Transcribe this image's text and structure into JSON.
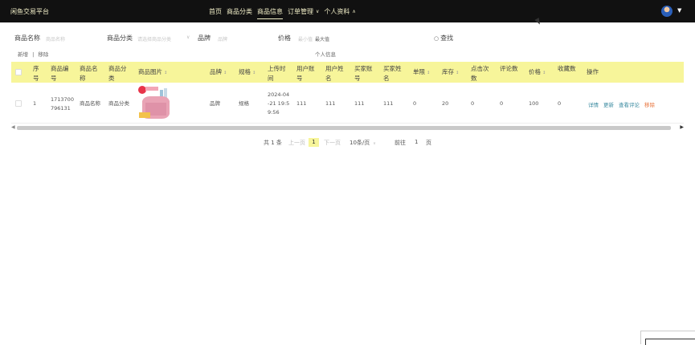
{
  "brand": "闲鱼交易平台",
  "nav": {
    "home": "首页",
    "category": "商品分类",
    "goods_info": "商品信息",
    "order_mgmt": "订单管理",
    "profile": "个人资料"
  },
  "search": {
    "name_label": "商品名称",
    "name_placeholder": "商品名称",
    "category_label": "商品分类",
    "category_placeholder": "请选择商品分类",
    "brand_label": "品牌",
    "brand_placeholder": "品牌",
    "price_label": "价格",
    "price_min_placeholder": "最小值",
    "price_max_placeholder": "最大值",
    "find_button": "查找"
  },
  "toolbar": {
    "add": "新增",
    "divider": "|",
    "remove": "移除",
    "center_text": "个人信息"
  },
  "table": {
    "headers": {
      "index": "序号",
      "code": "商品编号",
      "name": "商品名称",
      "category": "商品分类",
      "image": "商品图片",
      "brand": "品牌",
      "spec": "规格",
      "time": "上传时间",
      "user_account": "用户账号",
      "user_name": "用户姓名",
      "buyer_account": "买家账号",
      "buyer_name": "买家姓名",
      "limit": "单限",
      "stock": "库存",
      "clicks": "点击次数",
      "comments": "评论数",
      "price": "价格",
      "favorites": "收藏数",
      "ops": "操作"
    },
    "row": {
      "index": "1",
      "code_line1": "1713700",
      "code_line2": "796131",
      "name": "商品名称",
      "category": "商品分类",
      "brand": "品牌",
      "spec": "规格",
      "time_line1": "2024-04",
      "time_line2": "-21 19:5",
      "time_line3": "9:56",
      "user_account": "111",
      "user_name": "111",
      "buyer_account": "111",
      "buyer_name": "111",
      "limit": "0",
      "stock": "20",
      "clicks": "0",
      "comments": "0",
      "price": "100",
      "favorites": "0",
      "op_detail": "详情",
      "op_edit": "更新",
      "op_comments": "查看评论",
      "op_remove": "移除"
    }
  },
  "pagination": {
    "total": "共 1 条",
    "prev": "上一页",
    "current": "1",
    "next": "下一页",
    "page_size": "10条/页",
    "goto_label": "前往",
    "goto_value": "1",
    "page_unit": "页"
  },
  "colors": {
    "topbar": "#111111",
    "accent_yellow": "#f7f59a",
    "link_teal": "#3a8aa0",
    "link_orange": "#e8733a"
  }
}
